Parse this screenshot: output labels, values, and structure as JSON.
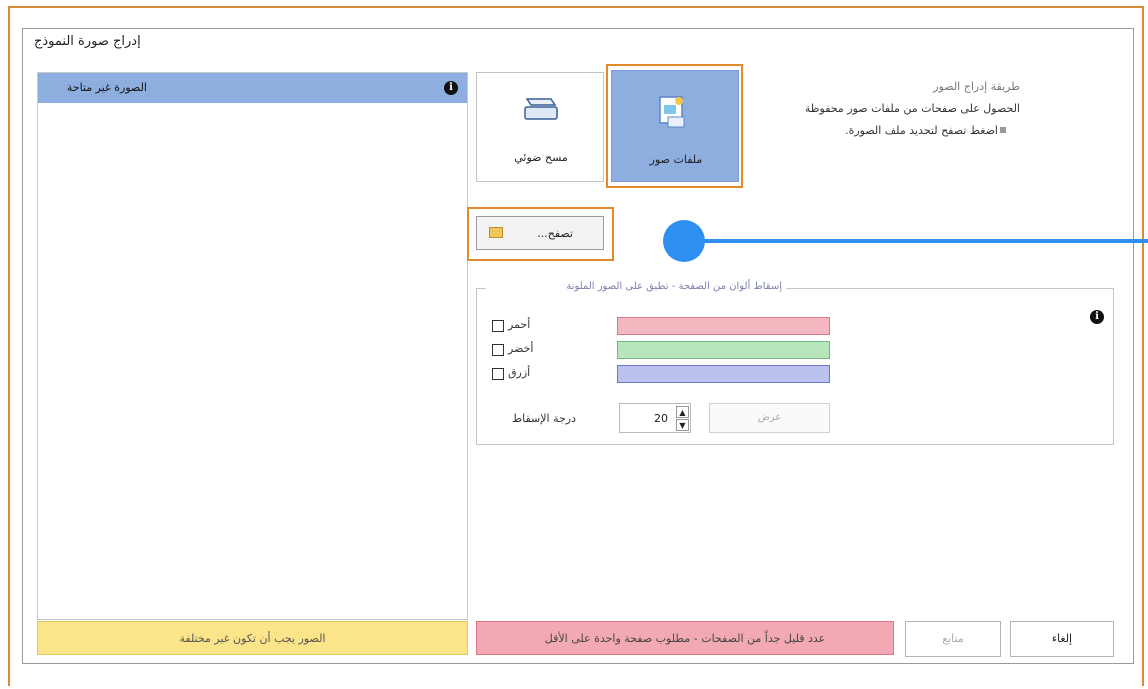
{
  "dialog": {
    "title": "إدراج صورة النموذج"
  },
  "left_panel": {
    "selected_item": "الصورة غير متاحة",
    "status": "الصور يجب أن تكون غير مختلفة"
  },
  "import_method": {
    "label": "طريقة إدراج الصور",
    "description": "الحصول على صفحات من ملفات صور محفوظة",
    "hint": "اضغط تصفح لتحديد ملف الصورة.",
    "tiles": [
      {
        "label": "ملفات صور",
        "icon": "image-file-icon",
        "selected": true
      },
      {
        "label": "مسح ضوئي",
        "icon": "scanner-icon",
        "selected": false
      }
    ],
    "browse_label": "تصفح..."
  },
  "dropout": {
    "legend": "إسقاط ألوان من الصفحة - تطبق على الصور الملونة",
    "colors": [
      {
        "label": "أحمر",
        "swatch": "#f6b8c0",
        "border": "#d47a88",
        "checked": false
      },
      {
        "label": "أخضر",
        "swatch": "#b7e6bd",
        "border": "#6fb97c",
        "checked": false
      },
      {
        "label": "أزرق",
        "swatch": "#bcc2ee",
        "border": "#6f78c7",
        "checked": false
      }
    ],
    "degree_label": "درجة الإسقاط",
    "degree_value": "20",
    "apply_label": "عرض"
  },
  "footer": {
    "error": "عدد قليل جداً من الصفحات - مطلوب صفحة واحدة على الأقل",
    "next_label": "متابع",
    "finish_label": "إلغاء"
  },
  "colors": {
    "highlight": "#e38b2c",
    "selection": "#8eaee0",
    "annotation": "#2f8ff0"
  }
}
